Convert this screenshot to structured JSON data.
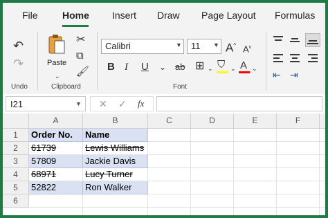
{
  "ribbon_tabs": [
    "File",
    "Home",
    "Insert",
    "Draw",
    "Page Layout",
    "Formulas"
  ],
  "active_tab": "Home",
  "clipboard": {
    "paste_label": "Paste",
    "group_label": "Clipboard"
  },
  "undo": {
    "group_label": "Undo"
  },
  "font": {
    "name": "Calibri",
    "size": "11",
    "group_label": "Font",
    "fill_color": "#ffff00",
    "text_color": "#ff0000"
  },
  "formula_bar": {
    "name_box": "I21",
    "fx": "fx",
    "formula": ""
  },
  "grid": {
    "columns": [
      "A",
      "B",
      "C",
      "D",
      "E",
      "F"
    ],
    "rows": [
      "1",
      "2",
      "3",
      "4",
      "5",
      "6"
    ],
    "cells": [
      {
        "order": "Order No.",
        "name": "Name"
      },
      {
        "order": "61739",
        "name": "Lewis Williams"
      },
      {
        "order": "57809",
        "name": "Jackie Davis"
      },
      {
        "order": "68971",
        "name": "Lucy Turner"
      },
      {
        "order": "52822",
        "name": "Ron Walker"
      }
    ],
    "highlight_color": "#d9e1f2"
  }
}
